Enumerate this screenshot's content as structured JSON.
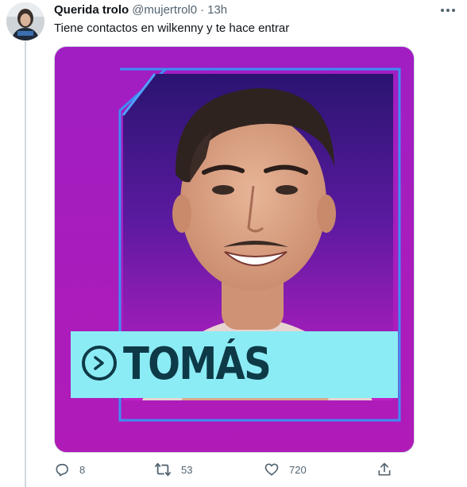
{
  "tweet": {
    "author": {
      "display_name": "Querida trolo",
      "handle": "@mujertrol0",
      "separator": "·",
      "time": "13h"
    },
    "text": "Tiene contactos en wilkenny y te hace entrar",
    "media": {
      "banner_name": "TOMÁS",
      "icon": "chevron-right-circle-icon"
    },
    "actions": {
      "reply": {
        "icon": "reply-icon",
        "count": "8"
      },
      "retweet": {
        "icon": "retweet-icon",
        "count": "53"
      },
      "like": {
        "icon": "heart-icon",
        "count": "720"
      },
      "share": {
        "icon": "share-icon"
      }
    },
    "menu_icon": "more-icon"
  },
  "colors": {
    "frame_purple": "#a51cc0",
    "frame_border": "#3d8ff5",
    "banner_cyan": "#8cecf5",
    "banner_text": "#0e3a48",
    "muted_text": "#536471"
  }
}
